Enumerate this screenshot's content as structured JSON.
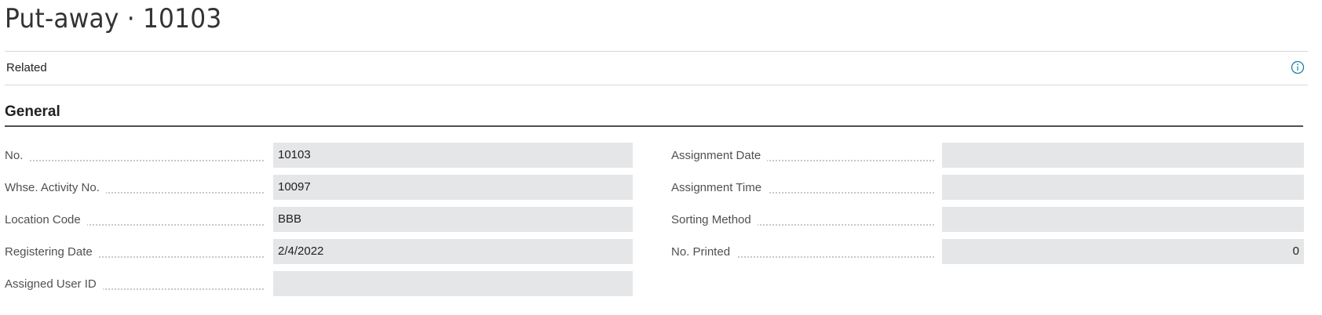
{
  "page": {
    "title": "Put-away · 10103"
  },
  "actionbar": {
    "related_label": "Related",
    "info_icon": "info-icon"
  },
  "general": {
    "title": "General",
    "left_fields": [
      {
        "label": "No.",
        "value": "10103"
      },
      {
        "label": "Whse. Activity No.",
        "value": "10097"
      },
      {
        "label": "Location Code",
        "value": "BBB"
      },
      {
        "label": "Registering Date",
        "value": "2/4/2022"
      },
      {
        "label": "Assigned User ID",
        "value": ""
      }
    ],
    "right_fields": [
      {
        "label": "Assignment Date",
        "value": ""
      },
      {
        "label": "Assignment Time",
        "value": ""
      },
      {
        "label": "Sorting Method",
        "value": ""
      },
      {
        "label": "No. Printed",
        "value": "0"
      }
    ]
  },
  "colors": {
    "field_background": "#e5e6e7",
    "accent_icon": "#1a7fa6"
  }
}
